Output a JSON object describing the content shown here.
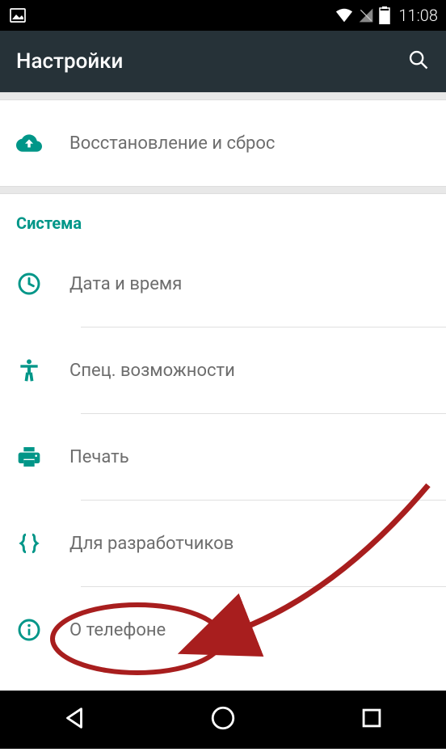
{
  "status": {
    "time": "11:08"
  },
  "appbar": {
    "title": "Настройки"
  },
  "items": {
    "backup_reset": "Восстановление и сброс",
    "date_time": "Дата и время",
    "accessibility": "Спец. возможности",
    "printing": "Печать",
    "developer": "Для разработчиков",
    "about": "О телефоне"
  },
  "section": {
    "system": "Система"
  }
}
